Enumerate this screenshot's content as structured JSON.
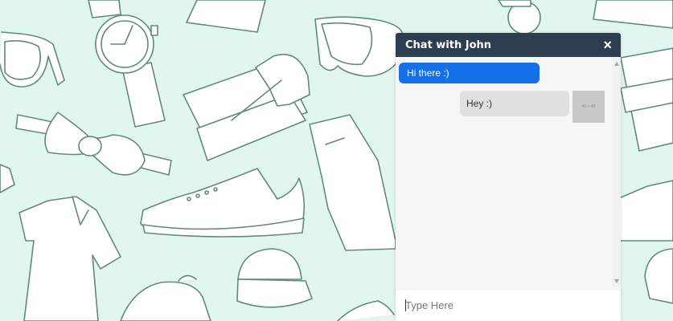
{
  "chat": {
    "title": "Chat with John",
    "close_symbol": "×",
    "messages": [
      {
        "from": "john",
        "text": "Hi there :)"
      },
      {
        "from": "me",
        "text": "Hey :)",
        "avatar_label": "40 × 40"
      }
    ],
    "input": {
      "placeholder": "Type Here",
      "value": ""
    }
  },
  "colors": {
    "background": "#e2f6f1",
    "header": "#2c3e50",
    "incoming_bubble": "#1370e6",
    "outgoing_bubble": "#e0e0e0"
  },
  "icons": {
    "close": "close-icon",
    "scroll_up": "arrow-up-icon",
    "scroll_down": "arrow-down-icon"
  }
}
